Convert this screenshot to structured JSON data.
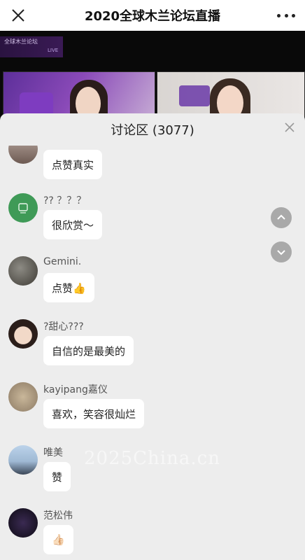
{
  "header": {
    "title": "2020全球木兰论坛直播",
    "close_icon": "close-icon",
    "more_icon": "more-icon"
  },
  "video": {
    "logo_text": "全球木兰论坛",
    "live_text": "LIVE"
  },
  "panel": {
    "title": "讨论区 (3077)",
    "close_icon": "close-icon"
  },
  "messages": [
    {
      "username": "",
      "text": "点赞真实"
    },
    {
      "username": "?? ？？？",
      "text": "很欣赏～"
    },
    {
      "username": "Gemini.",
      "text": "点赞👍"
    },
    {
      "username": "?甜心???",
      "text": "自信的是最美的"
    },
    {
      "username": "kayipang嘉仪",
      "text": "喜欢，笑容很灿烂"
    },
    {
      "username": "唯美",
      "text": "赞"
    },
    {
      "username": "范松伟",
      "text": "👍🏻"
    }
  ],
  "controls": {
    "scroll_up_icon": "chevron-up-icon",
    "scroll_down_icon": "chevron-down-icon"
  },
  "watermark": "2025China.cn"
}
